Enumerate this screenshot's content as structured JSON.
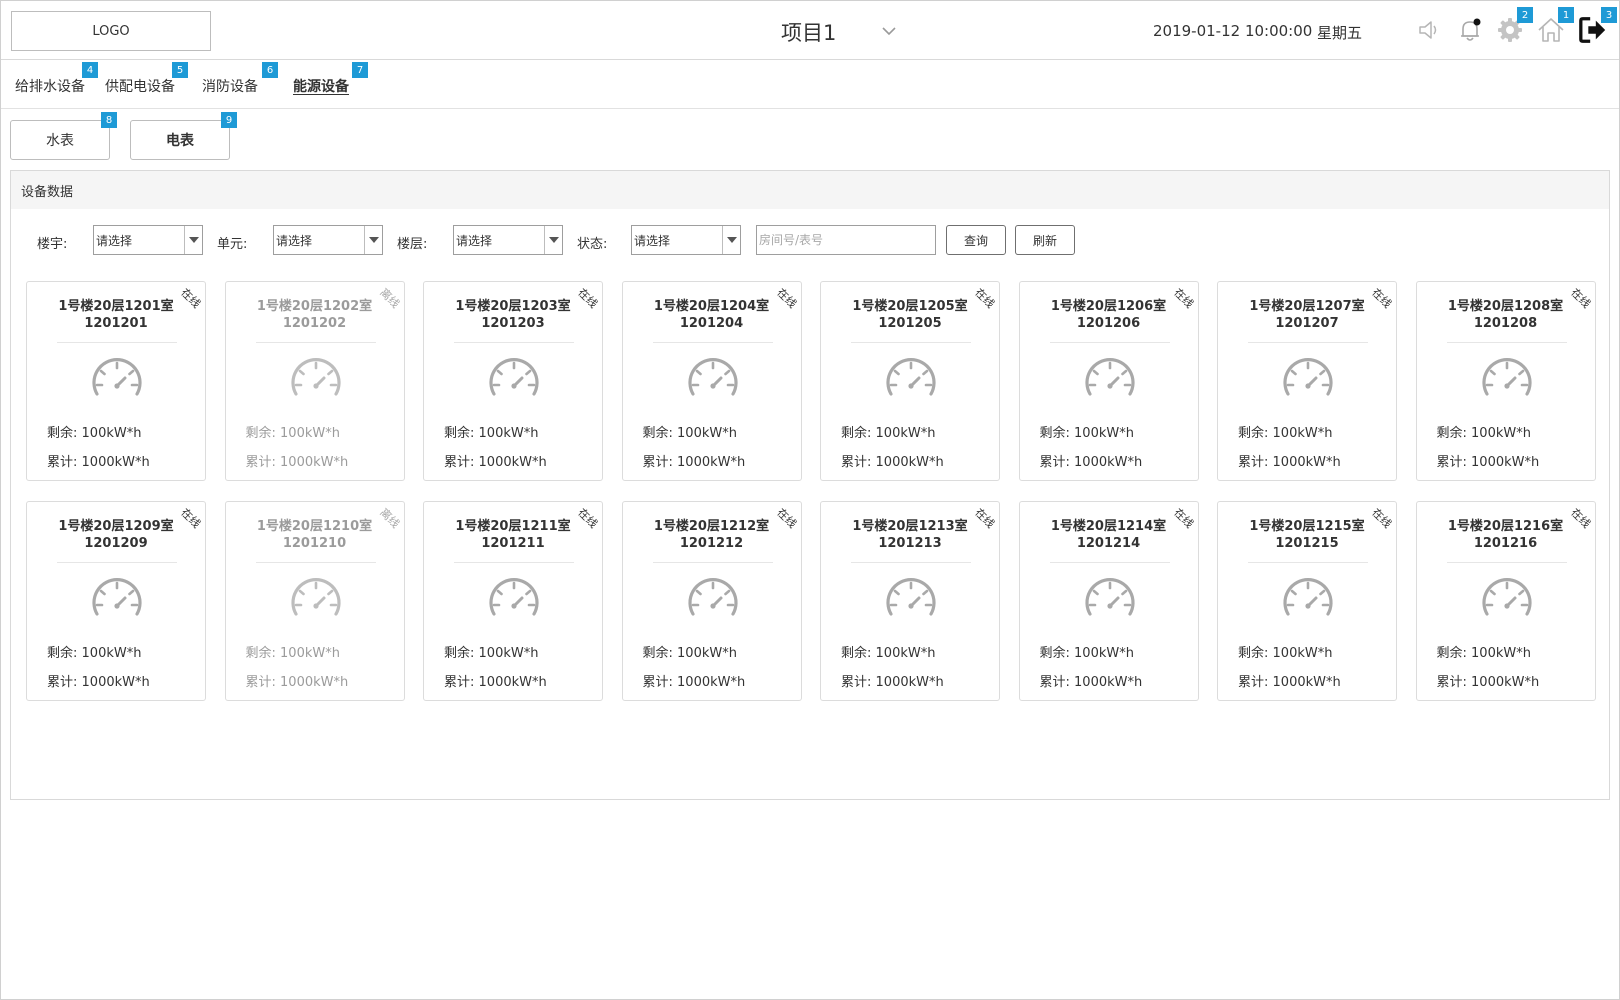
{
  "header": {
    "logo": "LOGO",
    "project": "项目1",
    "datetime": "2019-01-12 10:00:00",
    "weekday": "星期五",
    "badges": {
      "settings": "2",
      "home": "1",
      "logout": "3"
    }
  },
  "nav": {
    "items": [
      {
        "label": "给排水设备",
        "badge": "4"
      },
      {
        "label": "供配电设备",
        "badge": "5"
      },
      {
        "label": "消防设备",
        "badge": "6"
      },
      {
        "label": "能源设备",
        "badge": "7"
      }
    ],
    "active_index": 3
  },
  "subtabs": {
    "items": [
      {
        "label": "水表",
        "badge": "8"
      },
      {
        "label": "电表",
        "badge": "9"
      }
    ],
    "active_index": 1
  },
  "panel": {
    "title": "设备数据",
    "filters": {
      "building_label": "楼宇:",
      "unit_label": "单元:",
      "floor_label": "楼层:",
      "status_label": "状态:",
      "select_value": "请选择",
      "search_placeholder": "房间号/表号",
      "query_button": "查询",
      "refresh_button": "刷新"
    }
  },
  "labels": {
    "remaining": "剩余:",
    "total": "累计:"
  },
  "colors": {
    "badge": "#1e9ad6",
    "offline_text": "#9b9b9b"
  },
  "meters": [
    {
      "room": "1号楼20层1201室",
      "meter_no": "1201201",
      "status": "在线",
      "online": true,
      "remaining": "100kW*h",
      "total": "1000kW*h"
    },
    {
      "room": "1号楼20层1202室",
      "meter_no": "1201202",
      "status": "离线",
      "online": false,
      "remaining": "100kW*h",
      "total": "1000kW*h"
    },
    {
      "room": "1号楼20层1203室",
      "meter_no": "1201203",
      "status": "在线",
      "online": true,
      "remaining": "100kW*h",
      "total": "1000kW*h"
    },
    {
      "room": "1号楼20层1204室",
      "meter_no": "1201204",
      "status": "在线",
      "online": true,
      "remaining": "100kW*h",
      "total": "1000kW*h"
    },
    {
      "room": "1号楼20层1205室",
      "meter_no": "1201205",
      "status": "在线",
      "online": true,
      "remaining": "100kW*h",
      "total": "1000kW*h"
    },
    {
      "room": "1号楼20层1206室",
      "meter_no": "1201206",
      "status": "在线",
      "online": true,
      "remaining": "100kW*h",
      "total": "1000kW*h"
    },
    {
      "room": "1号楼20层1207室",
      "meter_no": "1201207",
      "status": "在线",
      "online": true,
      "remaining": "100kW*h",
      "total": "1000kW*h"
    },
    {
      "room": "1号楼20层1208室",
      "meter_no": "1201208",
      "status": "在线",
      "online": true,
      "remaining": "100kW*h",
      "total": "1000kW*h"
    },
    {
      "room": "1号楼20层1209室",
      "meter_no": "1201209",
      "status": "在线",
      "online": true,
      "remaining": "100kW*h",
      "total": "1000kW*h"
    },
    {
      "room": "1号楼20层1210室",
      "meter_no": "1201210",
      "status": "离线",
      "online": false,
      "remaining": "100kW*h",
      "total": "1000kW*h"
    },
    {
      "room": "1号楼20层1211室",
      "meter_no": "1201211",
      "status": "在线",
      "online": true,
      "remaining": "100kW*h",
      "total": "1000kW*h"
    },
    {
      "room": "1号楼20层1212室",
      "meter_no": "1201212",
      "status": "在线",
      "online": true,
      "remaining": "100kW*h",
      "total": "1000kW*h"
    },
    {
      "room": "1号楼20层1213室",
      "meter_no": "1201213",
      "status": "在线",
      "online": true,
      "remaining": "100kW*h",
      "total": "1000kW*h"
    },
    {
      "room": "1号楼20层1214室",
      "meter_no": "1201214",
      "status": "在线",
      "online": true,
      "remaining": "100kW*h",
      "total": "1000kW*h"
    },
    {
      "room": "1号楼20层1215室",
      "meter_no": "1201215",
      "status": "在线",
      "online": true,
      "remaining": "100kW*h",
      "total": "1000kW*h"
    },
    {
      "room": "1号楼20层1216室",
      "meter_no": "1201216",
      "status": "在线",
      "online": true,
      "remaining": "100kW*h",
      "total": "1000kW*h"
    }
  ]
}
